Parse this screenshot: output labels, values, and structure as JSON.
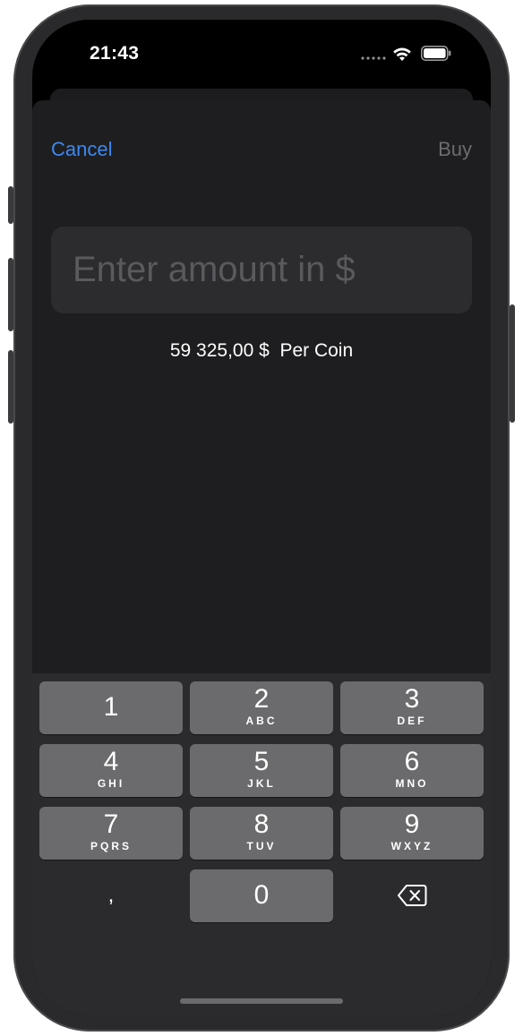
{
  "status_bar": {
    "time": "21:43",
    "wifi_icon": "wifi-icon",
    "battery_icon": "battery-icon"
  },
  "nav": {
    "cancel_label": "Cancel",
    "buy_label": "Buy"
  },
  "amount_field": {
    "value": "",
    "placeholder": "Enter amount in $"
  },
  "price": {
    "text": "59 325,00 $  Per Coin"
  },
  "keypad": {
    "keys": [
      {
        "digit": "1",
        "letters": ""
      },
      {
        "digit": "2",
        "letters": "ABC"
      },
      {
        "digit": "3",
        "letters": "DEF"
      },
      {
        "digit": "4",
        "letters": "GHI"
      },
      {
        "digit": "5",
        "letters": "JKL"
      },
      {
        "digit": "6",
        "letters": "MNO"
      },
      {
        "digit": "7",
        "letters": "PQRS"
      },
      {
        "digit": "8",
        "letters": "TUV"
      },
      {
        "digit": "9",
        "letters": "WXYZ"
      },
      {
        "digit": ",",
        "letters": ""
      },
      {
        "digit": "0",
        "letters": ""
      }
    ],
    "delete_icon": "delete-backspace-icon"
  },
  "colors": {
    "accent": "#3c87f0",
    "sheet_background": "#1e1e20",
    "keyboard_background": "#2b2b2d",
    "key_background": "#6b6b6d"
  }
}
